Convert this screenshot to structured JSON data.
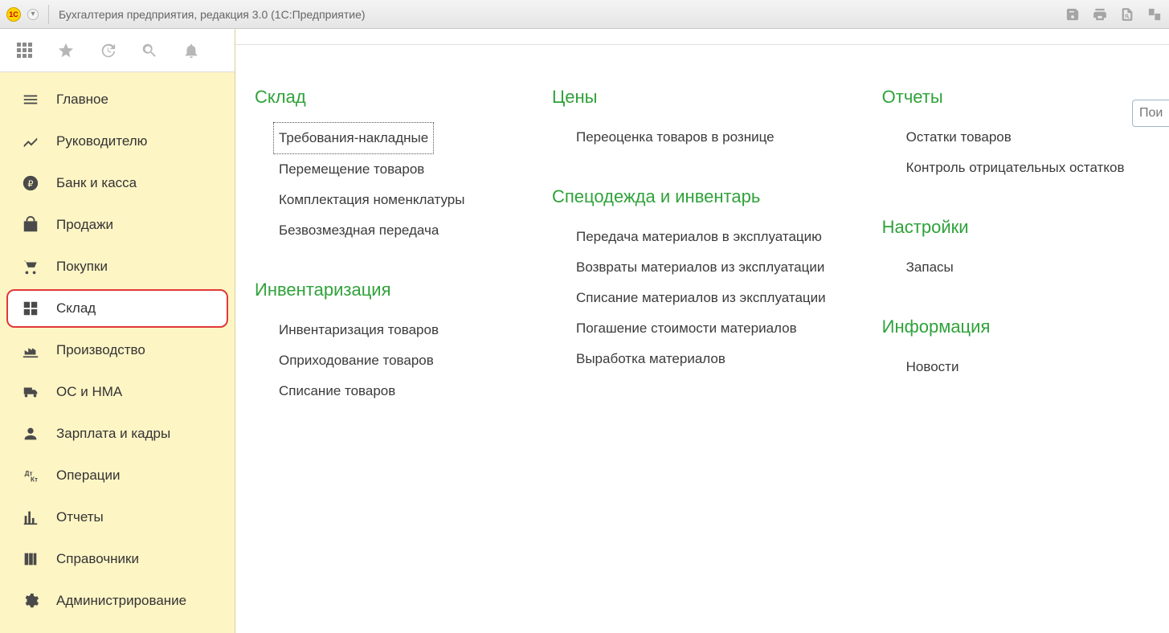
{
  "titlebar": {
    "title": "Бухгалтерия предприятия, редакция 3.0  (1С:Предприятие)"
  },
  "search": {
    "placeholder": "Поиск"
  },
  "sidebar": {
    "items": [
      {
        "label": "Главное"
      },
      {
        "label": "Руководителю"
      },
      {
        "label": "Банк и касса"
      },
      {
        "label": "Продажи"
      },
      {
        "label": "Покупки"
      },
      {
        "label": "Склад",
        "active": true
      },
      {
        "label": "Производство"
      },
      {
        "label": "ОС и НМА"
      },
      {
        "label": "Зарплата и кадры"
      },
      {
        "label": "Операции"
      },
      {
        "label": "Отчеты"
      },
      {
        "label": "Справочники"
      },
      {
        "label": "Администрирование"
      }
    ]
  },
  "columns": [
    {
      "sections": [
        {
          "title": "Склад",
          "links": [
            {
              "label": "Требования-накладные",
              "focused": true
            },
            {
              "label": "Перемещение товаров"
            },
            {
              "label": "Комплектация номенклатуры"
            },
            {
              "label": "Безвозмездная передача"
            }
          ]
        },
        {
          "title": "Инвентаризация",
          "links": [
            {
              "label": "Инвентаризация товаров"
            },
            {
              "label": "Оприходование товаров"
            },
            {
              "label": "Списание товаров"
            }
          ]
        }
      ]
    },
    {
      "sections": [
        {
          "title": "Цены",
          "links": [
            {
              "label": "Переоценка товаров в рознице"
            }
          ]
        },
        {
          "title": "Спецодежда и инвентарь",
          "links": [
            {
              "label": "Передача материалов в эксплуатацию"
            },
            {
              "label": "Возвраты материалов из эксплуатации"
            },
            {
              "label": "Списание материалов из эксплуатации"
            },
            {
              "label": "Погашение стоимости материалов"
            },
            {
              "label": "Выработка материалов"
            }
          ]
        }
      ]
    },
    {
      "sections": [
        {
          "title": "Отчеты",
          "links": [
            {
              "label": "Остатки товаров"
            },
            {
              "label": "Контроль отрицательных остатков"
            }
          ]
        },
        {
          "title": "Настройки",
          "links": [
            {
              "label": "Запасы"
            }
          ]
        },
        {
          "title": "Информация",
          "links": [
            {
              "label": "Новости"
            }
          ]
        }
      ]
    }
  ]
}
